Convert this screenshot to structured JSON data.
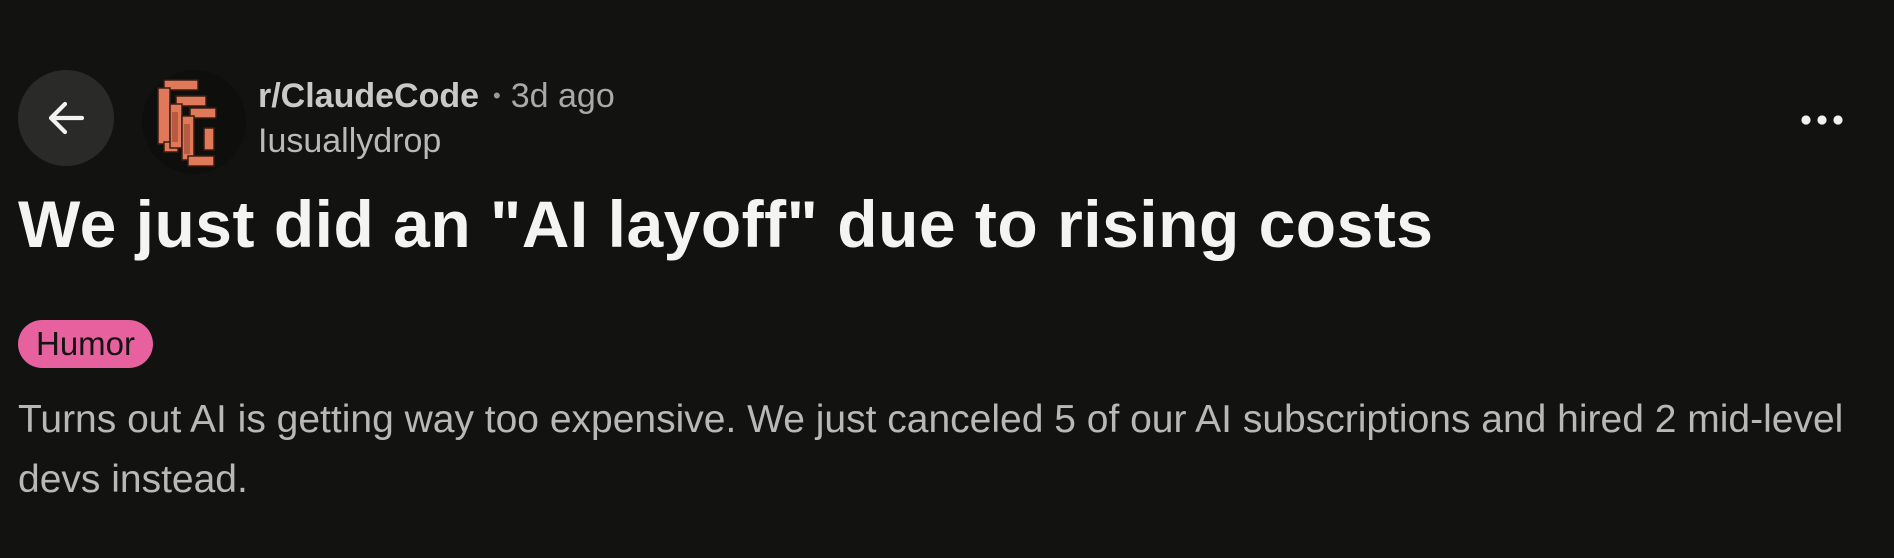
{
  "post": {
    "subreddit": "r/ClaudeCode",
    "separator": "•",
    "time": "3d ago",
    "username": "Iusuallydrop",
    "title": "We just did an \"AI layoff\" due to rising costs",
    "flair": "Humor",
    "body": "Turns out AI is getting way too expensive. We just canceled 5 of our AI subscriptions and hired 2 mid-level devs instead."
  },
  "icons": {
    "back": "arrow-left-icon",
    "more": "more-horizontal-icon",
    "avatar": "subreddit-avatar"
  },
  "colors": {
    "background": "#121211",
    "flair": "#e6619e",
    "avatar_accent": "#e0785a"
  }
}
